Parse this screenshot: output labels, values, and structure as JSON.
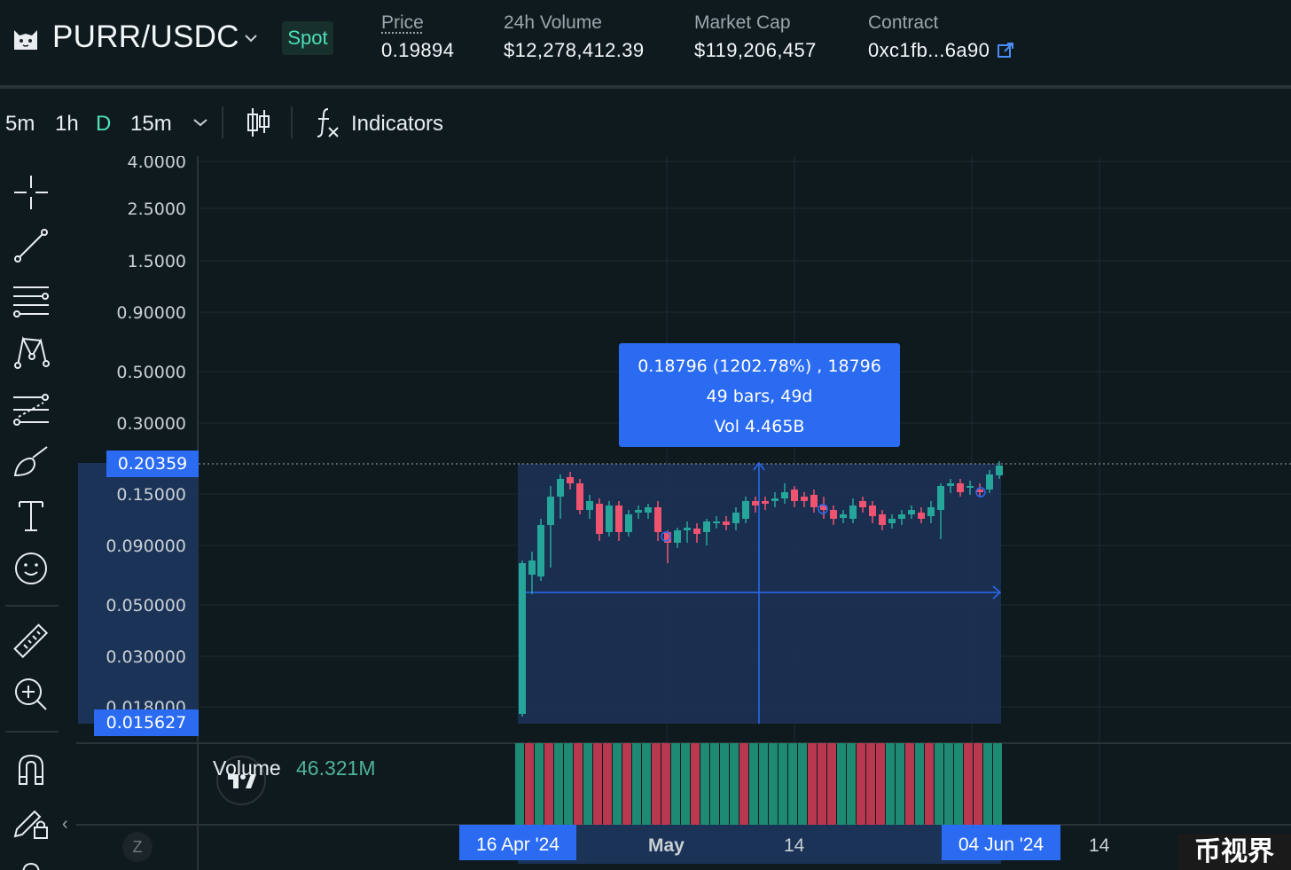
{
  "header": {
    "pair": "PURR/USDC",
    "market_type": "Spot",
    "stats": [
      {
        "label": "Price",
        "value": "0.19894"
      },
      {
        "label": "24h Volume",
        "value": "$12,278,412.39"
      },
      {
        "label": "Market Cap",
        "value": "$119,206,457"
      },
      {
        "label": "Contract",
        "value": "0xc1fb...6a90"
      }
    ]
  },
  "toolbar": {
    "timeframes": [
      "5m",
      "1h",
      "D",
      "15m"
    ],
    "active_timeframe": "D",
    "indicators_label": "Indicators"
  },
  "left_tools": [
    "crosshair-icon",
    "trendline-icon",
    "fib-retracement-icon",
    "pattern-icon",
    "prediction-icon",
    "brush-icon",
    "text-icon",
    "emoji-icon",
    "ruler-icon",
    "zoom-in-icon",
    "magnet-icon",
    "lock-drawings-icon"
  ],
  "price_axis": {
    "ticks": [
      "4.0000",
      "2.5000",
      "1.5000",
      "0.90000",
      "0.50000",
      "0.30000",
      "0.15000",
      "0.090000",
      "0.050000",
      "0.030000",
      "0.018000"
    ],
    "current_price_tag": "0.20359",
    "range_low_tag": "0.015627"
  },
  "measure": {
    "line1": "0.18796 (1202.78%) , 18796",
    "line2": "49 bars, 49d",
    "line3": "Vol 4.465B"
  },
  "volume": {
    "label": "Volume",
    "value": "46.321M"
  },
  "time_axis": {
    "range_start": "16 Apr '24",
    "range_end": "04 Jun '24",
    "labels": [
      "May",
      "14",
      "14"
    ]
  },
  "controls": {
    "z_label": "Z",
    "collapse": "‹"
  },
  "colors": {
    "background": "#0f1a1f",
    "accent": "#2a6bf2",
    "up": "#26a69a",
    "down": "#ef5370",
    "spot_text": "#4fe0b9"
  },
  "watermark": "币视界"
}
